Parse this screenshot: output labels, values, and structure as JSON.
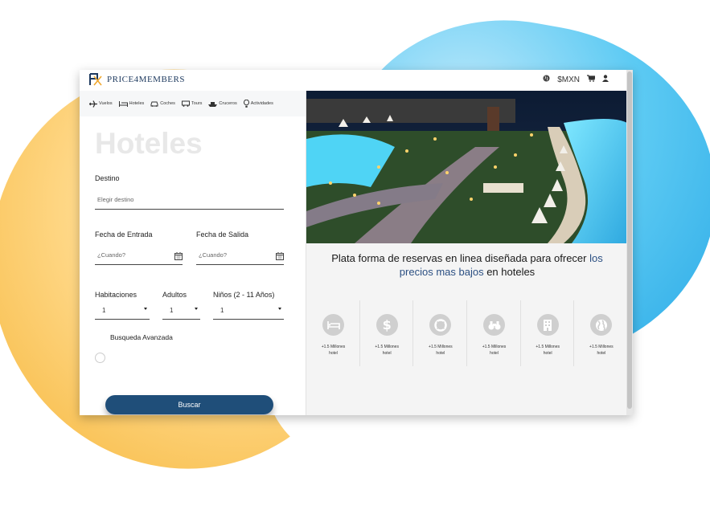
{
  "brand": {
    "name": "PRICE4MEMBERS"
  },
  "topbar": {
    "currency": "$MXN"
  },
  "nav": [
    {
      "label": "Vuelos",
      "icon": "plane-icon"
    },
    {
      "label": "Hoteles",
      "icon": "bed-icon"
    },
    {
      "label": "Coches",
      "icon": "car-icon"
    },
    {
      "label": "Tours",
      "icon": "bus-icon"
    },
    {
      "label": "Cruceros",
      "icon": "ship-icon"
    },
    {
      "label": "Actividades",
      "icon": "balloon-icon"
    }
  ],
  "page_title": "Hoteles",
  "form": {
    "destino": {
      "label": "Destino",
      "placeholder": "Elegir destino"
    },
    "entrada": {
      "label": "Fecha de Entrada",
      "placeholder": "¿Cuando?"
    },
    "salida": {
      "label": "Fecha de Salida",
      "placeholder": "¿Cuando?"
    },
    "habitaciones": {
      "label": "Habitaciones",
      "value": "1"
    },
    "adultos": {
      "label": "Adultos",
      "value": "1"
    },
    "ninos": {
      "label": "Niños (2 - 11 Años)",
      "value": "1"
    },
    "advanced": "Busqueda Avanzada",
    "submit": "Buscar"
  },
  "tagline": {
    "part1": "Plata forma de reservas en linea diseñada para ofrecer ",
    "highlight": "los precios mas bajos",
    "part2": " en hoteles"
  },
  "features": [
    {
      "icon": "bed-icon",
      "line1": "+1.5 Millones",
      "line2": "hotel"
    },
    {
      "icon": "dollar-icon",
      "line1": "+1.5 Millones",
      "line2": "hotel"
    },
    {
      "icon": "lifebuoy-icon",
      "line1": "+1.5 Millones",
      "line2": "hotel"
    },
    {
      "icon": "binoculars-icon",
      "line1": "+1.5 Millones",
      "line2": "hotel"
    },
    {
      "icon": "building-icon",
      "line1": "+1.5 Millones",
      "line2": "hotel"
    },
    {
      "icon": "globe-icon",
      "line1": "+1.5 Millones",
      "line2": "hotel"
    }
  ],
  "colors": {
    "primary": "#1f4e79",
    "accent_blue": "#2aa9e6",
    "accent_yellow": "#f6b73c"
  }
}
